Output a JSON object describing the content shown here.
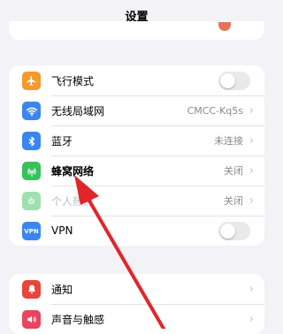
{
  "header": {
    "title": "设置"
  },
  "colors": {
    "airplane": "#f39a2c",
    "wifi": "#3a86f0",
    "bluetooth": "#3a86f0",
    "cellular": "#38c25a",
    "hotspot": "#9fe0ae",
    "vpn": "#3a86f0",
    "notifications": "#e8453c",
    "sounds": "#e8455e",
    "arrow": "#e0262a"
  },
  "network_group": [
    {
      "label": "飞行模式",
      "icon": "airplane-icon",
      "control": "toggle"
    },
    {
      "label": "无线局域网",
      "icon": "wifi-icon",
      "value": "CMCC-Kq5s"
    },
    {
      "label": "蓝牙",
      "icon": "bluetooth-icon",
      "value": "未连接"
    },
    {
      "label": "蜂窝网络",
      "icon": "cellular-antenna-icon",
      "value": "关闭"
    },
    {
      "label": "个人热点",
      "icon": "hotspot-icon",
      "value": "关闭"
    },
    {
      "label": "VPN",
      "icon": "vpn-icon",
      "icon_text": "VPN",
      "control": "toggle"
    }
  ],
  "notification_group": [
    {
      "label": "通知",
      "icon": "notification-bell-icon"
    },
    {
      "label": "声音与触感",
      "icon": "speaker-icon"
    }
  ]
}
